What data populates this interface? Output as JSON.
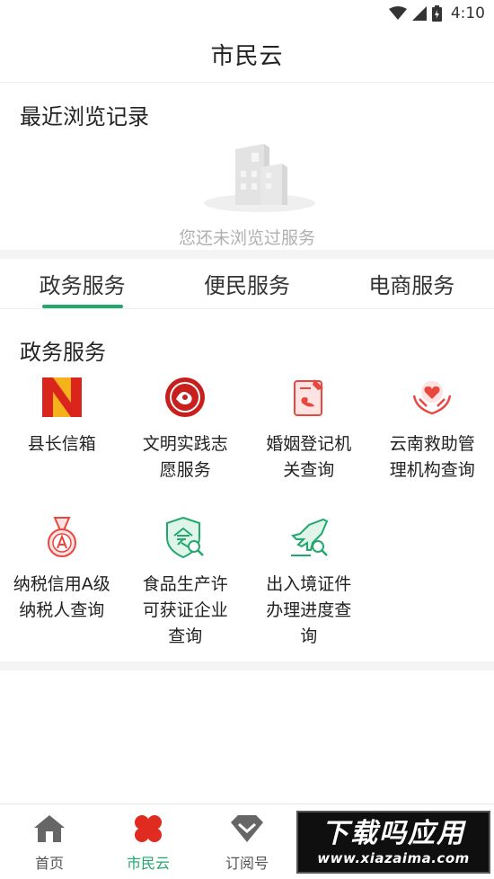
{
  "status_bar": {
    "time": "4:10"
  },
  "header": {
    "title": "市民云"
  },
  "recent": {
    "heading": "最近浏览记录",
    "empty_text": "您还未浏览过服务"
  },
  "tabs": [
    {
      "label": "政务服务",
      "active": true
    },
    {
      "label": "便民服务",
      "active": false
    },
    {
      "label": "电商服务",
      "active": false
    }
  ],
  "services": {
    "heading": "政务服务",
    "items": [
      {
        "label": "县长信箱",
        "icon": "county-mailbox-logo-icon"
      },
      {
        "label": "文明实践志愿服务",
        "icon": "volunteer-emblem-icon"
      },
      {
        "label": "婚姻登记机关查询",
        "icon": "marriage-registration-icon"
      },
      {
        "label": "云南救助管理机构查询",
        "icon": "rescue-hands-heart-icon"
      },
      {
        "label": "纳税信用A级纳税人查询",
        "icon": "a-grade-medal-icon"
      },
      {
        "label": "食品生产许可获证企业查询",
        "icon": "food-license-shield-icon"
      },
      {
        "label": "出入境证件办理进度查询",
        "icon": "airplane-search-icon"
      }
    ]
  },
  "bottom_nav": [
    {
      "label": "首页",
      "icon": "home-icon",
      "active": false
    },
    {
      "label": "市民云",
      "icon": "clover-icon",
      "active": true
    },
    {
      "label": "订阅号",
      "icon": "subscribe-icon",
      "active": false
    }
  ],
  "watermark": {
    "main": "下载吗应用",
    "url": "www.xiazaima.com"
  },
  "colors": {
    "accent": "#22a86c",
    "icon_red": "#e8473f",
    "nav_gray": "#666666"
  }
}
